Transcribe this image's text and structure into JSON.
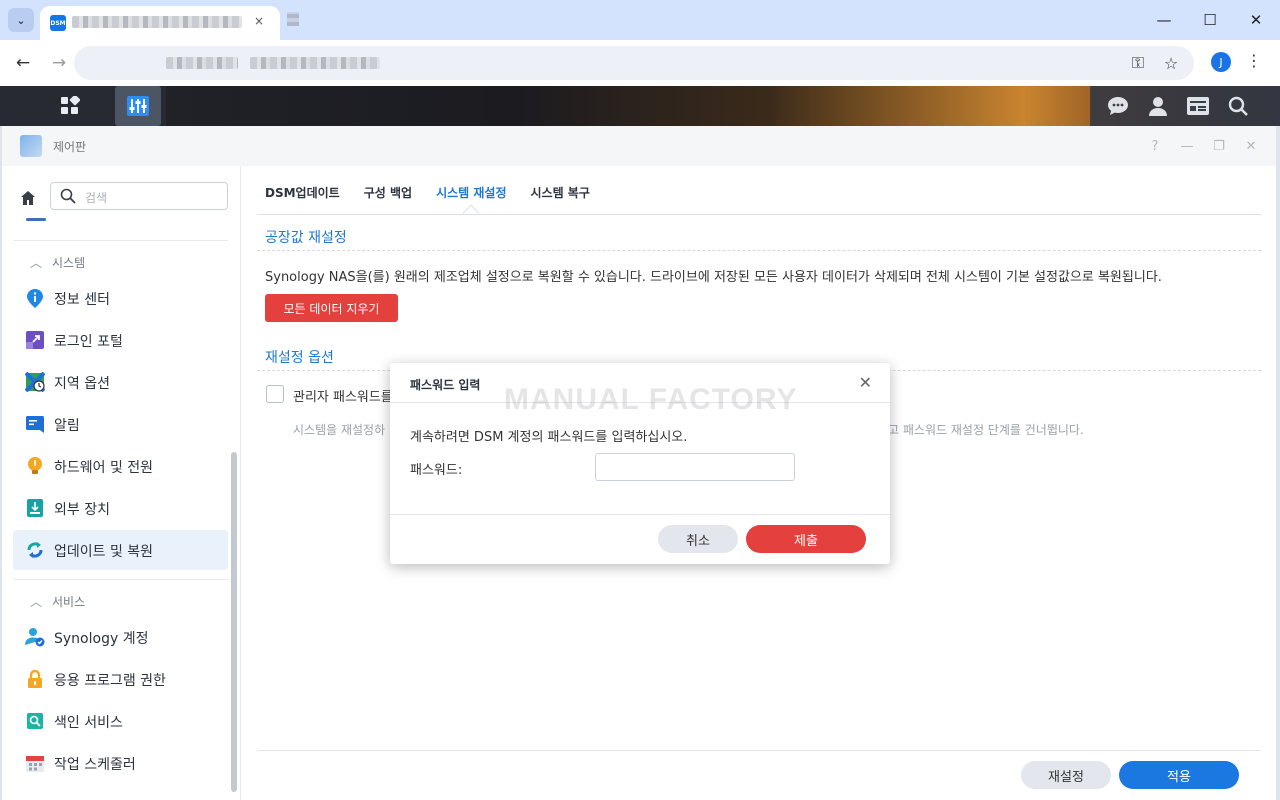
{
  "browser": {
    "tab_favicon_text": "DSM",
    "profile_initial": "J",
    "tab_close": "×",
    "tab_menu": "⌄",
    "window_controls": {
      "minimize": "—",
      "maximize": "☐",
      "close": "✕"
    },
    "nav": {
      "back": "←",
      "forward": "→",
      "reload": ""
    },
    "icons": {
      "key": "⚿",
      "star": "☆",
      "kebab": "⋮"
    }
  },
  "window": {
    "title": "제어판",
    "controls": {
      "help": "?",
      "minimize": "—",
      "restore": "❐",
      "close": "✕"
    }
  },
  "sidebar": {
    "search_placeholder": "검색",
    "groups": [
      {
        "label": "시스템",
        "items": [
          {
            "label": "정보 센터",
            "icon": "info-icon",
            "color": "#1e88e5"
          },
          {
            "label": "로그인 포털",
            "icon": "login-portal-icon",
            "color": "#6d4fc2"
          },
          {
            "label": "지역 옵션",
            "icon": "region-icon",
            "color": "#2e9d5c"
          },
          {
            "label": "알림",
            "icon": "notification-icon",
            "color": "#1e6fd6"
          },
          {
            "label": "하드웨어 및 전원",
            "icon": "lightbulb-icon",
            "color": "#f5a623"
          },
          {
            "label": "외부 장치",
            "icon": "external-device-icon",
            "color": "#17a2a6"
          },
          {
            "label": "업데이트 및 복원",
            "icon": "update-restore-icon",
            "color": "#18a7a0",
            "active": true
          }
        ]
      },
      {
        "label": "서비스",
        "items": [
          {
            "label": "Synology 계정",
            "icon": "synology-account-icon",
            "color": "#2aa3d9"
          },
          {
            "label": "응용 프로그램 권한",
            "icon": "lock-icon",
            "color": "#f5a623"
          },
          {
            "label": "색인 서비스",
            "icon": "index-service-icon",
            "color": "#1bb5a8"
          },
          {
            "label": "작업 스케줄러",
            "icon": "calendar-icon",
            "color": "#e0463f"
          }
        ]
      }
    ]
  },
  "main": {
    "tabs": [
      {
        "label": "DSM업데이트"
      },
      {
        "label": "구성 백업"
      },
      {
        "label": "시스템 재설정",
        "active": true
      },
      {
        "label": "시스템 복구"
      }
    ],
    "factory_reset": {
      "title": "공장값 재설정",
      "description": "Synology NAS을(를) 원래의 제조업체 설정으로 복원할 수 있습니다. 드라이브에 저장된 모든 사용자 데이터가 삭제되며 전체 시스템이 기본 설정값으로 복원됩니다.",
      "button": "모든 데이터 지우기"
    },
    "reset_options": {
      "title": "재설정 옵션",
      "checkbox_label": "관리자 패스워드를",
      "note_left": "시스템을 재설정하",
      "note_right": "않고 패스워드 재설정 단계를 건너뜁니다."
    },
    "footer": {
      "reset": "재설정",
      "apply": "적용"
    }
  },
  "dialog": {
    "title": "패스워드 입력",
    "close": "✕",
    "watermark": "MANUAL FACTORY",
    "message": "계속하려면 DSM 계정의 패스워드를 입력하십시오.",
    "password_label": "패스워드:",
    "password_value": "",
    "cancel": "취소",
    "submit": "제출"
  },
  "colors": {
    "accent": "#1a78e0",
    "danger": "#e4403e",
    "active_tab": "#1f78d1"
  }
}
